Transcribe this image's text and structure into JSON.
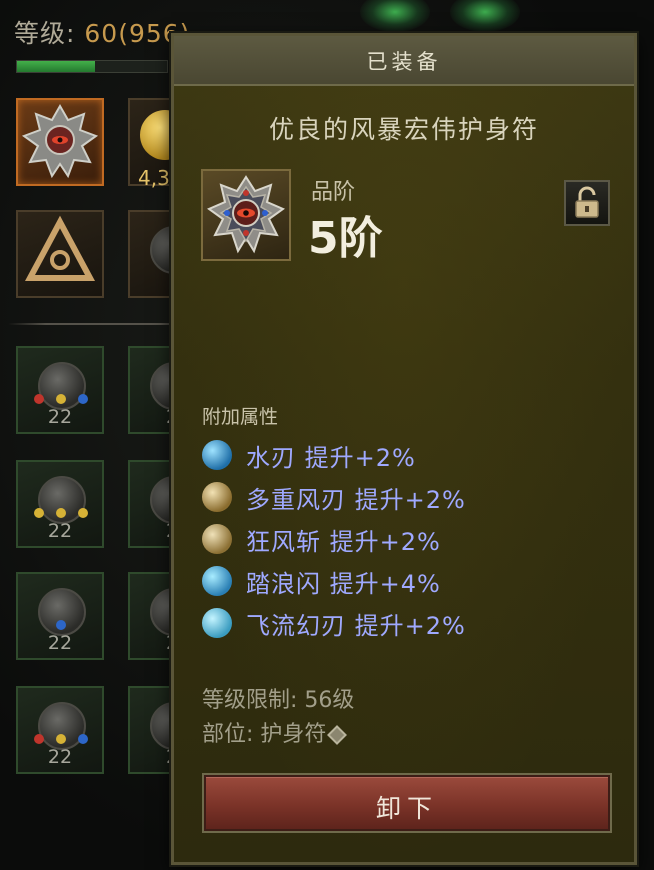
{
  "background": {
    "level_label": "等级:",
    "level_value": "60(956)",
    "xp_progress": 0.52,
    "gold_fragment": "4,3",
    "inventory_counts": [
      "22",
      "22",
      "22",
      "22"
    ],
    "inventory_counts_partial": [
      "2",
      "2",
      "2",
      "2"
    ]
  },
  "tooltip": {
    "header": "已装备",
    "item_name": "优良的风暴宏伟护身符",
    "item_icon": "storm-amulet-icon",
    "grade_label": "品阶",
    "grade_value": "5阶",
    "lock_icon": "unlocked-padlock-icon",
    "attributes_title": "附加属性",
    "attributes": [
      {
        "icon": "water-blade-skill-icon",
        "text": "水刃  提升+2%",
        "color": "#2f8fcf"
      },
      {
        "icon": "multi-wind-blade-skill-icon",
        "text": "多重风刃  提升+2%",
        "color": "#b99a52"
      },
      {
        "icon": "gale-slash-skill-icon",
        "text": "狂风斩  提升+2%",
        "color": "#b89b58"
      },
      {
        "icon": "wave-flash-skill-icon",
        "text": "踏浪闪  提升+4%",
        "color": "#3fa7d6"
      },
      {
        "icon": "flowing-phantom-blade-skill-icon",
        "text": "飞流幻刃  提升+2%",
        "color": "#55b9d4"
      }
    ],
    "level_requirement": "等级限制: 56级",
    "slot": "部位: 护身符",
    "slot_icon": "amulet-slot-icon",
    "unequip_label": "卸下"
  },
  "colors": {
    "attribute_text": "#9fa9ff",
    "panel_bg": "#34300f",
    "button_red": "#7b3328",
    "xp_green": "#43b04a"
  }
}
